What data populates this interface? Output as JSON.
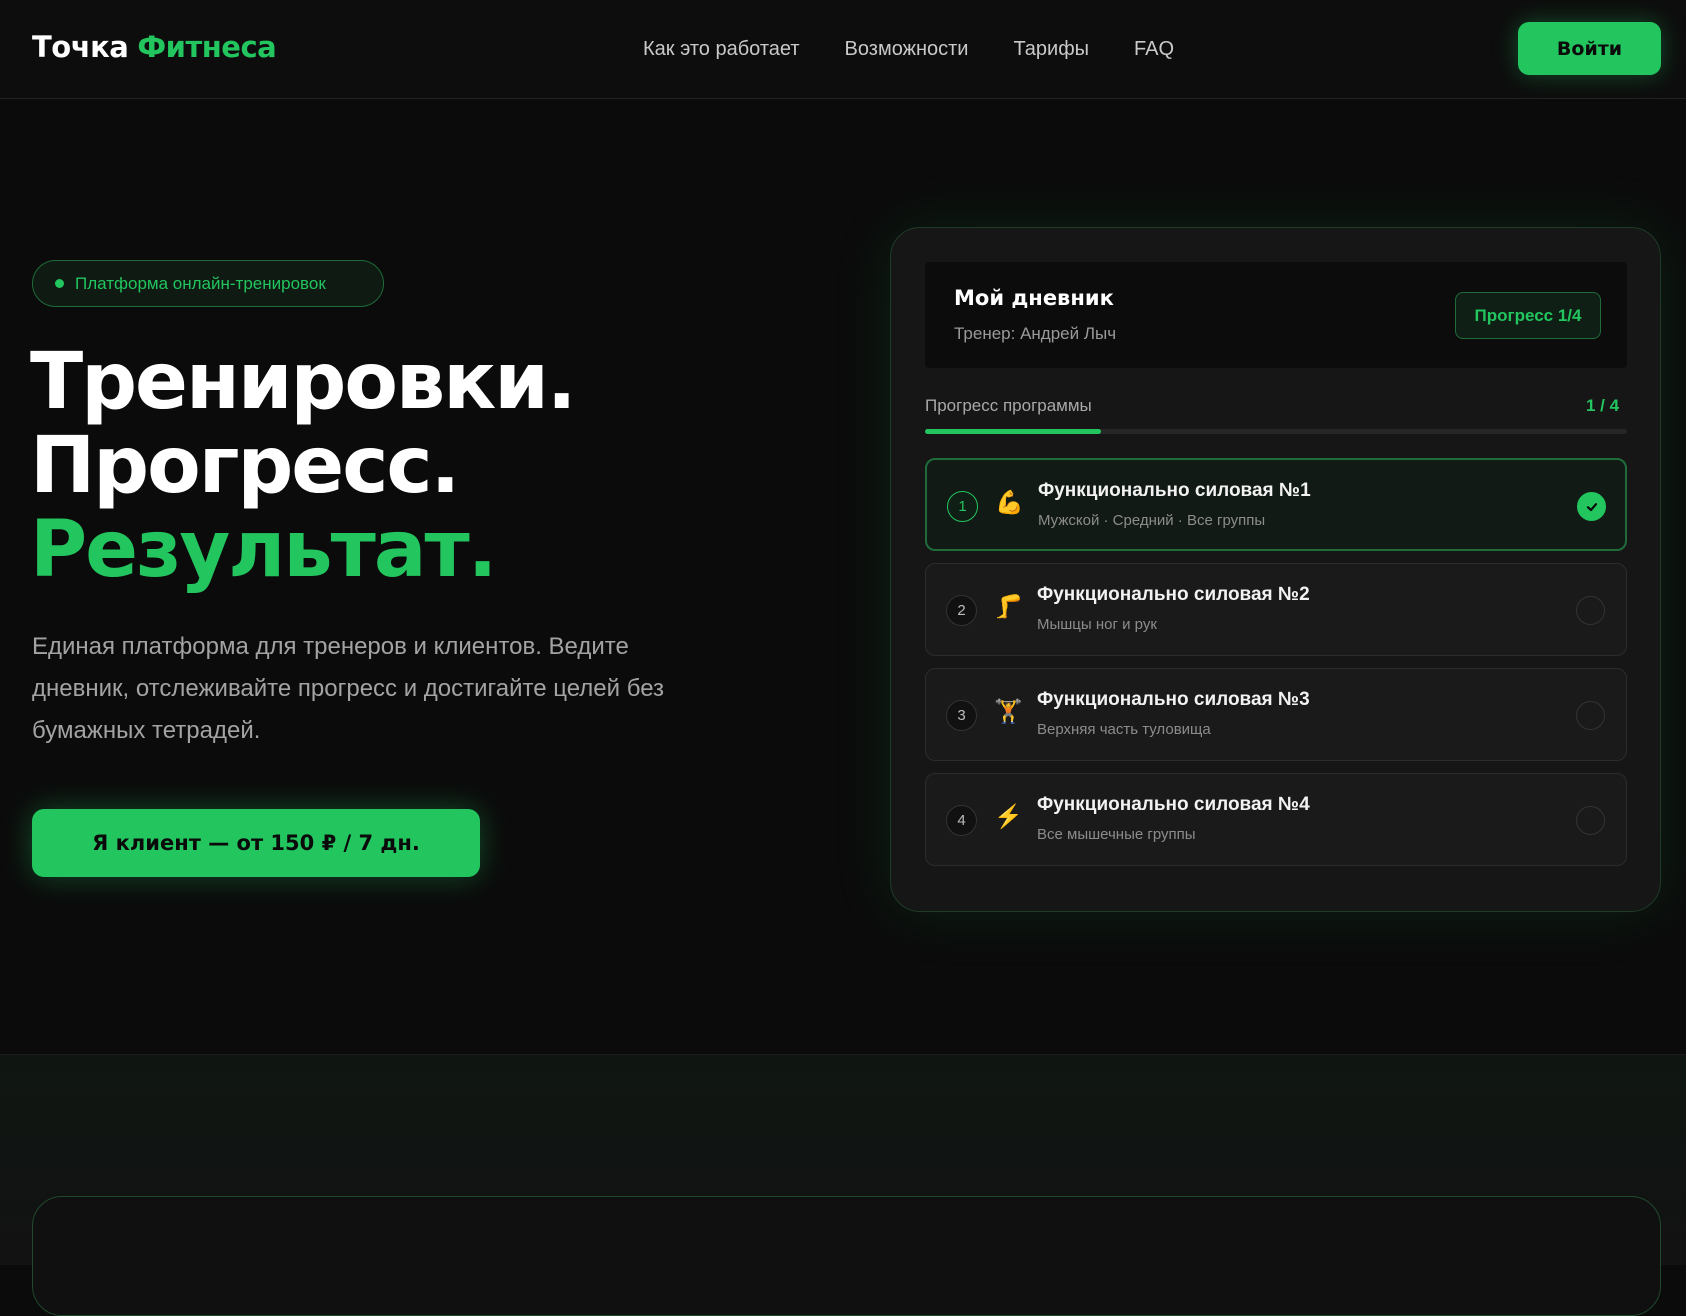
{
  "header": {
    "logo_part1": "Точка",
    "logo_part2": "Фитнеса",
    "nav": [
      "Как это работает",
      "Возможности",
      "Тарифы",
      "FAQ"
    ],
    "login_label": "Войти"
  },
  "hero": {
    "badge": "Платформа онлайн-тренировок",
    "headline": [
      "Тренировки.",
      "Прогресс.",
      "Результат."
    ],
    "description": "Единая платформа для тренеров и клиентов. Ведите дневник, отслеживайте прогресс и достигайте целей без бумажных тетрадей.",
    "cta_label": "Я клиент — от 150 ₽ / 7 дн."
  },
  "diary": {
    "title": "Мой дневник",
    "trainer": "Тренер: Андрей Лыч",
    "progress_badge": "Прогресс 1/4",
    "progress_label": "Прогресс программы",
    "progress_count": "1 / 4",
    "progress_fraction": 0.25,
    "workouts": [
      {
        "num": "1",
        "icon": "flexed-biceps-icon",
        "glyph": "💪",
        "title": "Функционально силовая №1",
        "subtitle": "Мужской · Средний · Все группы",
        "done": true
      },
      {
        "num": "2",
        "icon": "leg-icon",
        "glyph": "🦵",
        "title": "Функционально силовая №2",
        "subtitle": "Мышцы ног и рук",
        "done": false
      },
      {
        "num": "3",
        "icon": "weightlifter-icon",
        "glyph": "🏋",
        "title": "Функционально силовая №3",
        "subtitle": "Верхняя часть туловища",
        "done": false
      },
      {
        "num": "4",
        "icon": "lightning-icon",
        "glyph": "⚡",
        "title": "Функционально силовая №4",
        "subtitle": "Все мышечные группы",
        "done": false
      }
    ]
  },
  "colors": {
    "accent": "#22c55e",
    "background": "#0b0b0b",
    "card": "#161616"
  }
}
